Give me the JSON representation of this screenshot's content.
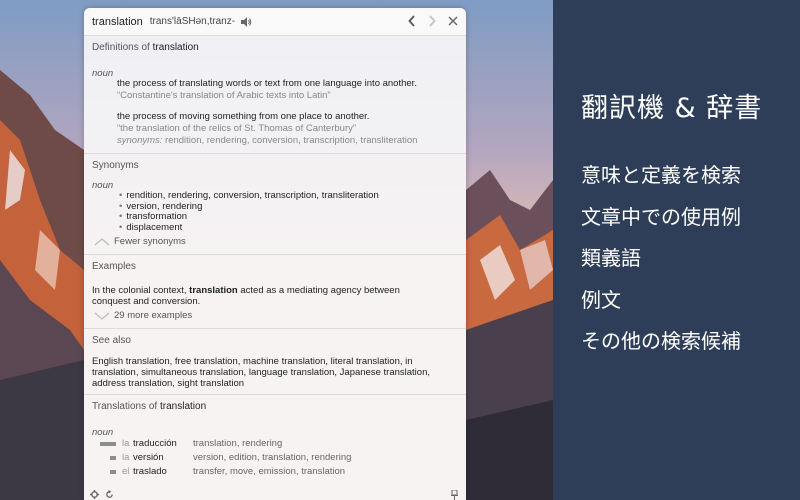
{
  "promo": {
    "title": "翻訳機 & 辞書",
    "features": [
      "意味と定義を検索",
      "文章中での使用例",
      "類義語",
      "例文",
      "その他の検索候補"
    ]
  },
  "header": {
    "word": "translation",
    "phonetic": "trans'lāSHən,tranz-",
    "speaker_icon": "speaker-icon",
    "back_icon": "chevron-left-icon",
    "forward_icon": "chevron-right-icon",
    "close_icon": "close-icon"
  },
  "definitions": {
    "title_prefix": "Definitions of ",
    "title_word": "translation",
    "pos": "noun",
    "items": [
      {
        "text": "the process of translating words or text from one language into another.",
        "example": "“Constantine's translation of Arabic texts into Latin”"
      },
      {
        "text": "the process of moving something from one place to another.",
        "example": "“the translation of the relics of St. Thomas of Canterbury”"
      }
    ],
    "synonyms_label": "synonyms:",
    "synonyms_text": " rendition, rendering, conversion, transcription, transliteration"
  },
  "synonyms": {
    "title": "Synonyms",
    "pos": "noun",
    "items": [
      "rendition, rendering, conversion, transcription, transliteration",
      "version, rendering",
      "transformation",
      "displacement"
    ],
    "toggle_label": "Fewer synonyms"
  },
  "examples": {
    "title": "Examples",
    "text_before": "In the colonial context, ",
    "text_bold": "translation",
    "text_after": " acted as a mediating agency between",
    "text_line2": "conquest and conversion.",
    "toggle_label": "29 more examples"
  },
  "see_also": {
    "title": "See also",
    "lines": [
      "English translation, free translation, machine translation, literal translation, in",
      "translation, simultaneous translation, language translation, Japanese translation,",
      "address translation, sight translation"
    ]
  },
  "translations": {
    "title_prefix": "Translations of ",
    "title_word": "translation",
    "pos": "noun",
    "rows": [
      {
        "article": "la",
        "word": "traducción",
        "meaning": "translation, rendering",
        "frequency": 1.0
      },
      {
        "article": "la",
        "word": "versión",
        "meaning": "version, edition, translation, rendering",
        "frequency": 0.4
      },
      {
        "article": "el",
        "word": "traslado",
        "meaning": "transfer, move, emission, translation",
        "frequency": 0.4
      }
    ]
  },
  "footer": {
    "settings_icon": "gear-icon",
    "refresh_icon": "refresh-icon",
    "pin_icon": "pin-icon"
  }
}
